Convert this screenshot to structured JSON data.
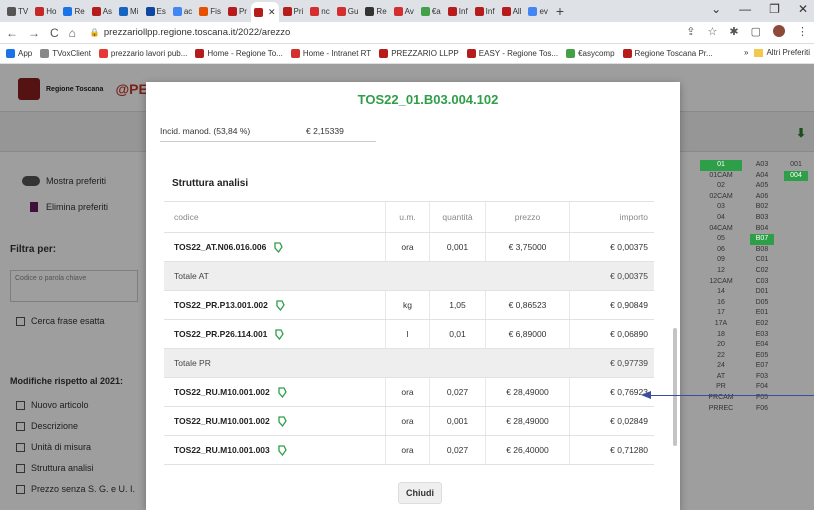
{
  "browser": {
    "tabs": [
      {
        "label": "TV",
        "color": "#555"
      },
      {
        "label": "Ho",
        "color": "#c62828"
      },
      {
        "label": "Re",
        "color": "#1a73e8"
      },
      {
        "label": "As",
        "color": "#b71c1c"
      },
      {
        "label": "Mi",
        "color": "#1565c0"
      },
      {
        "label": "Es",
        "color": "#0d47a1"
      },
      {
        "label": "ac",
        "color": "#4285f4"
      },
      {
        "label": "Fis",
        "color": "#e65100"
      },
      {
        "label": "Pr",
        "color": "#b71c1c"
      },
      {
        "label": "",
        "color": "#b71c1c",
        "active": true
      },
      {
        "label": "Pri",
        "color": "#b71c1c"
      },
      {
        "label": "nc",
        "color": "#d32f2f"
      },
      {
        "label": "Gu",
        "color": "#d32f2f"
      },
      {
        "label": "Re",
        "color": "#333"
      },
      {
        "label": "Av",
        "color": "#d32f2f"
      },
      {
        "label": "€a",
        "color": "#43a047"
      },
      {
        "label": "Inf",
        "color": "#b71c1c"
      },
      {
        "label": "Inf",
        "color": "#b71c1c"
      },
      {
        "label": "All",
        "color": "#b71c1c"
      },
      {
        "label": "ev",
        "color": "#4285f4"
      }
    ],
    "url": "prezzariollpp.regione.toscana.it/2022/arezzo",
    "bookmarks": [
      {
        "label": "App",
        "color": "#1a73e8"
      },
      {
        "label": "TVoxClient",
        "color": "#888"
      },
      {
        "label": "prezzario lavori pub...",
        "color": "#e53935"
      },
      {
        "label": "Home - Regione To...",
        "color": "#b71c1c"
      },
      {
        "label": "Home - Intranet RT",
        "color": "#d32f2f"
      },
      {
        "label": "PREZZARIO LLPP",
        "color": "#b71c1c"
      },
      {
        "label": "EASY - Regione Tos...",
        "color": "#b71c1c"
      },
      {
        "label": "€asycomp",
        "color": "#43a047"
      },
      {
        "label": "Regione Toscana Pr...",
        "color": "#b71c1c"
      }
    ],
    "bookmarks_more": "»",
    "bookmarks_other": "Altri Preferiti"
  },
  "site": {
    "logo_text": "Regione Toscana",
    "logo_brand": "@PEN"
  },
  "sidebar": {
    "show_favorites": "Mostra preferiti",
    "delete_favorites": "Elimina preferiti",
    "filter_title": "Filtra per:",
    "code_placeholder": "Codice o parola chiave",
    "exact_phrase": "Cerca frase esatta",
    "changes_title": "Modifiche rispetto al 2021:",
    "changes": [
      "Nuovo articolo",
      "Descrizione",
      "Unità di misura",
      "Struttura analisi",
      "Prezzo senza S. G. e U. I."
    ]
  },
  "right_columns": {
    "col1": [
      "01",
      "01CAM",
      "02",
      "02CAM",
      "03",
      "04",
      "04CAM",
      "05",
      "06",
      "09",
      "12",
      "12CAM",
      "14",
      "16",
      "17",
      "17A",
      "18",
      "20",
      "22",
      "24",
      "AT",
      "PR",
      "PRCAM",
      "PRREC"
    ],
    "col2": [
      "A03",
      "A04",
      "A05",
      "A06",
      "B02",
      "B03",
      "B04",
      "B07",
      "B08",
      "C01",
      "C02",
      "C03",
      "D01",
      "D05",
      "E01",
      "E02",
      "E03",
      "E04",
      "E05",
      "E07",
      "F03",
      "F04",
      "F05",
      "F06"
    ],
    "col3": [
      "001",
      "004"
    ],
    "highlight_color": "#2e9e48"
  },
  "modal": {
    "title": "TOS22_01.B03.004.102",
    "incid_label": "Incid. manod. (53,84 %)",
    "incid_value": "€ 2,15339",
    "section_title": "Struttura analisi",
    "headers": {
      "codice": "codice",
      "um": "u.m.",
      "quantita": "quantità",
      "prezzo": "prezzo",
      "importo": "importo"
    },
    "rows": [
      {
        "codice": "TOS22_AT.N06.016.006",
        "um": "ora",
        "quantita": "0,001",
        "prezzo": "€ 3,75000",
        "importo": "€ 0,00375"
      },
      {
        "total": "Totale AT",
        "importo": "€ 0,00375"
      },
      {
        "codice": "TOS22_PR.P13.001.002",
        "um": "kg",
        "quantita": "1,05",
        "prezzo": "€ 0,86523",
        "importo": "€ 0,90849"
      },
      {
        "codice": "TOS22_PR.P26.114.001",
        "um": "l",
        "quantita": "0,01",
        "prezzo": "€ 6,89000",
        "importo": "€ 0,06890"
      },
      {
        "total": "Totale PR",
        "importo": "€ 0,97739"
      },
      {
        "codice": "TOS22_RU.M10.001.002",
        "um": "ora",
        "quantita": "0,027",
        "prezzo": "€ 28,49000",
        "importo": "€ 0,76923"
      },
      {
        "codice": "TOS22_RU.M10.001.002",
        "um": "ora",
        "quantita": "0,001",
        "prezzo": "€ 28,49000",
        "importo": "€ 0,02849"
      },
      {
        "codice": "TOS22_RU.M10.001.003",
        "um": "ora",
        "quantita": "0,027",
        "prezzo": "€ 26,40000",
        "importo": "€ 0,71280"
      }
    ],
    "close_label": "Chiudi",
    "tag_color": "#2e9e48",
    "title_color": "#2e9e48"
  },
  "annotation": {
    "arrow_color": "#3a4ea0"
  }
}
